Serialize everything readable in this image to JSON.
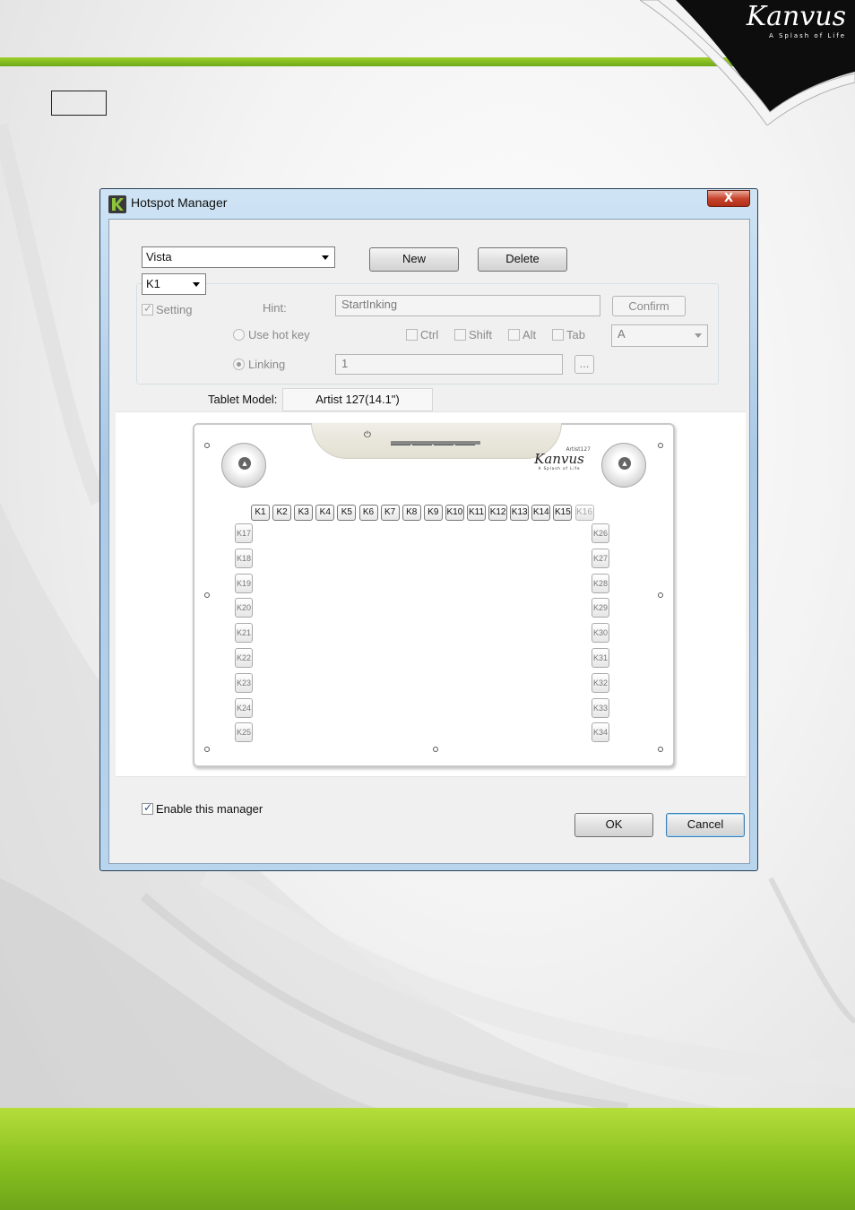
{
  "header": {
    "brand_name": "Kanvus",
    "brand_tagline": "A Splash of Life"
  },
  "window": {
    "title": "Hotspot Manager",
    "close_label": "X",
    "profile_combo": "Vista",
    "new_button": "New",
    "delete_button": "Delete",
    "key_combo": "K1",
    "setting_label": "Setting",
    "hint_label": "Hint:",
    "hint_value": "StartInking",
    "confirm_button": "Confirm",
    "use_hot_key_label": "Use hot key",
    "modifiers": {
      "ctrl": "Ctrl",
      "shift": "Shift",
      "alt": "Alt",
      "tab": "Tab"
    },
    "hotkey_combo": "A",
    "linking_label": "Linking",
    "linking_value": "1",
    "browse_button": "...",
    "tablet_model_label": "Tablet Model:",
    "tablet_model_value": "Artist 127(14.1\")",
    "enable_manager_label": "Enable this manager",
    "ok_button": "OK",
    "cancel_button": "Cancel"
  },
  "tablet": {
    "brand": "Kanvus",
    "model_text": "Artist127",
    "tagline": "A Splash of Life",
    "top_keys": [
      "K1",
      "K2",
      "K3",
      "K4",
      "K5",
      "K6",
      "K7",
      "K8",
      "K9",
      "K10",
      "K11",
      "K12",
      "K13",
      "K14",
      "K15",
      "K16"
    ],
    "left_keys": [
      "K17",
      "K18",
      "K19",
      "K20",
      "K21",
      "K22",
      "K23",
      "K24",
      "K25"
    ],
    "right_keys": [
      "K26",
      "K27",
      "K28",
      "K29",
      "K30",
      "K31",
      "K32",
      "K33",
      "K34"
    ]
  },
  "colors": {
    "accent_green": "#8cc43a",
    "window_frame": "#b9d5ee",
    "close_red": "#c7452e"
  }
}
